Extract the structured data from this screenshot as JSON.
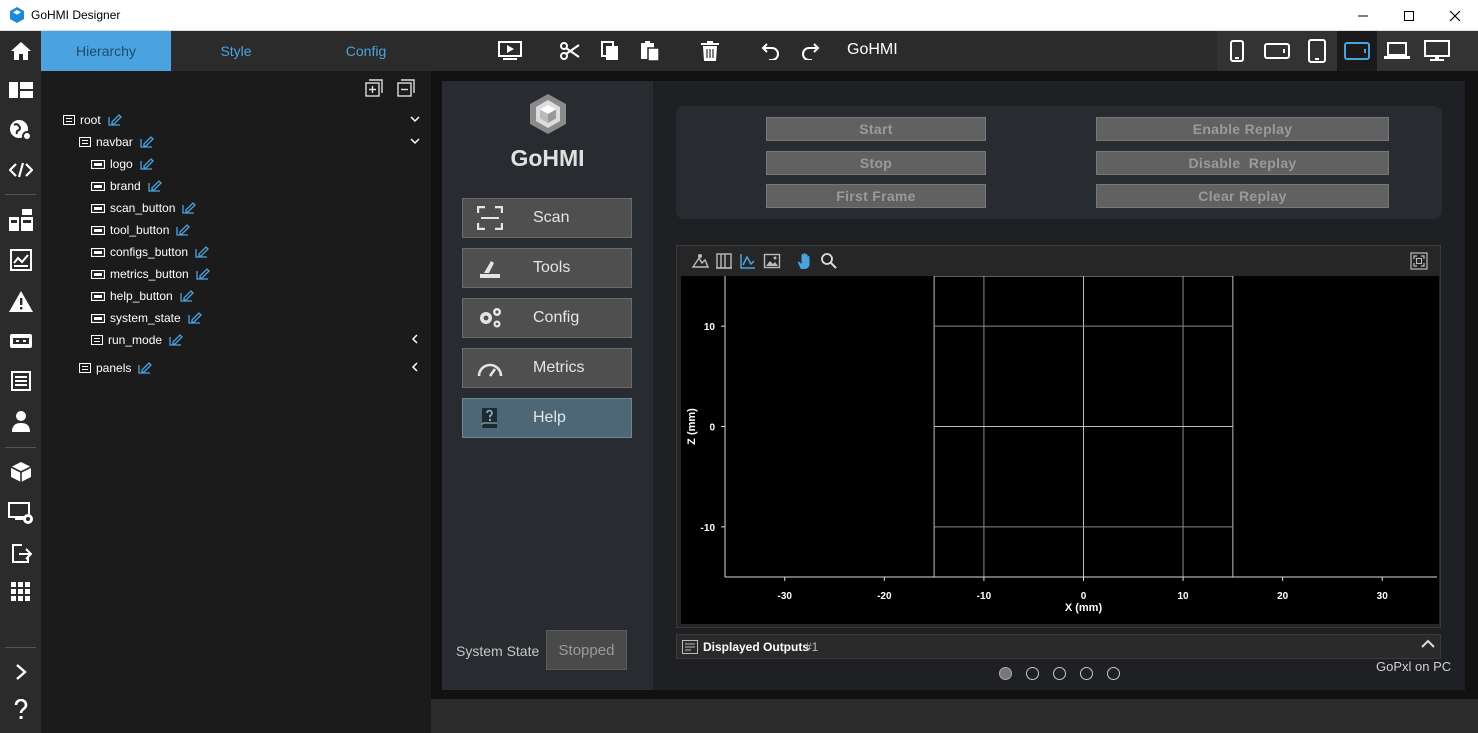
{
  "window": {
    "title": "GoHMI Designer"
  },
  "tabs": [
    {
      "label": "Hierarchy",
      "active": true
    },
    {
      "label": "Style",
      "active": false
    },
    {
      "label": "Config",
      "active": false
    }
  ],
  "toolbar": {
    "project_name": "GoHMI"
  },
  "tree": [
    {
      "label": "root",
      "level": 0,
      "expanded": true
    },
    {
      "label": "navbar",
      "level": 1,
      "expanded": true
    },
    {
      "label": "logo",
      "level": 2
    },
    {
      "label": "brand",
      "level": 2
    },
    {
      "label": "scan_button",
      "level": 2
    },
    {
      "label": "tool_button",
      "level": 2
    },
    {
      "label": "configs_button",
      "level": 2
    },
    {
      "label": "metrics_button",
      "level": 2
    },
    {
      "label": "help_button",
      "level": 2
    },
    {
      "label": "system_state",
      "level": 2
    },
    {
      "label": "run_mode",
      "level": 2,
      "expanded": false
    },
    {
      "label": "panels",
      "level": 1,
      "expanded": false
    }
  ],
  "preview": {
    "brand": "GoHMI",
    "nav": [
      {
        "label": "Scan",
        "icon": "scan-icon"
      },
      {
        "label": "Tools",
        "icon": "tools-icon"
      },
      {
        "label": "Config",
        "icon": "gears-icon"
      },
      {
        "label": "Metrics",
        "icon": "gauge-icon"
      },
      {
        "label": "Help",
        "icon": "help-book-icon",
        "active": true
      }
    ],
    "system_state": {
      "label": "System State",
      "value": "Stopped"
    },
    "controls": {
      "start": "Start",
      "stop": "Stop",
      "first_frame": "First Frame",
      "enable_replay": "Enable Replay",
      "disable_replay": "Disable  Replay",
      "clear_replay": "Clear Replay"
    },
    "outputs": {
      "label": "Displayed Outputs",
      "index": "#1"
    },
    "footer": "GoPxl on PC",
    "pager": {
      "count": 5,
      "active": 0
    }
  },
  "chart_data": {
    "type": "scatter",
    "xlabel": "X (mm)",
    "ylabel": "Z (mm)",
    "xlim": [
      -36,
      35.5
    ],
    "ylim": [
      -15,
      15
    ],
    "xticks": [
      -30,
      -20,
      -10,
      0,
      10,
      20,
      30
    ],
    "yticks": [
      -10,
      0,
      10
    ],
    "grid": true,
    "grid_region": {
      "x": [
        -15,
        15
      ],
      "z": [
        -15,
        15
      ]
    },
    "grid_x_lines": [
      -15,
      -10,
      0,
      10,
      15
    ],
    "grid_z_lines": [
      -15,
      -10,
      0,
      10,
      15
    ],
    "series": []
  }
}
